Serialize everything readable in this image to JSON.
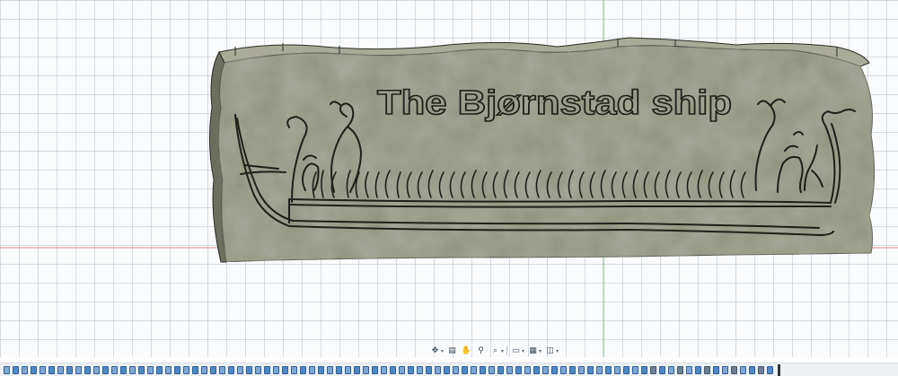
{
  "viewport": {
    "model_text": "The Bjørnstad ship",
    "colors": {
      "stone_face": "#8e917a",
      "stone_side": "#6c6f5c",
      "stone_top": "#a9ab97",
      "outline": "#2a2c24",
      "grid_line": "#c8cfd8",
      "x_axis": "#e88a8a",
      "y_axis": "#88c98c"
    }
  },
  "navigation_toolbar": {
    "items": [
      {
        "name": "orbit",
        "icon": "orbit-icon"
      },
      {
        "name": "look-at",
        "icon": "look-at-icon"
      },
      {
        "name": "pan",
        "icon": "pan-hand-icon"
      },
      {
        "name": "zoom",
        "icon": "zoom-icon"
      },
      {
        "name": "fit",
        "icon": "zoom-window-icon"
      },
      {
        "name": "display-settings",
        "icon": "display-settings-icon"
      },
      {
        "name": "grid-and-snaps",
        "icon": "grid-icon"
      },
      {
        "name": "viewports",
        "icon": "viewports-icon"
      }
    ]
  },
  "timeline": {
    "feature_count": 86
  }
}
